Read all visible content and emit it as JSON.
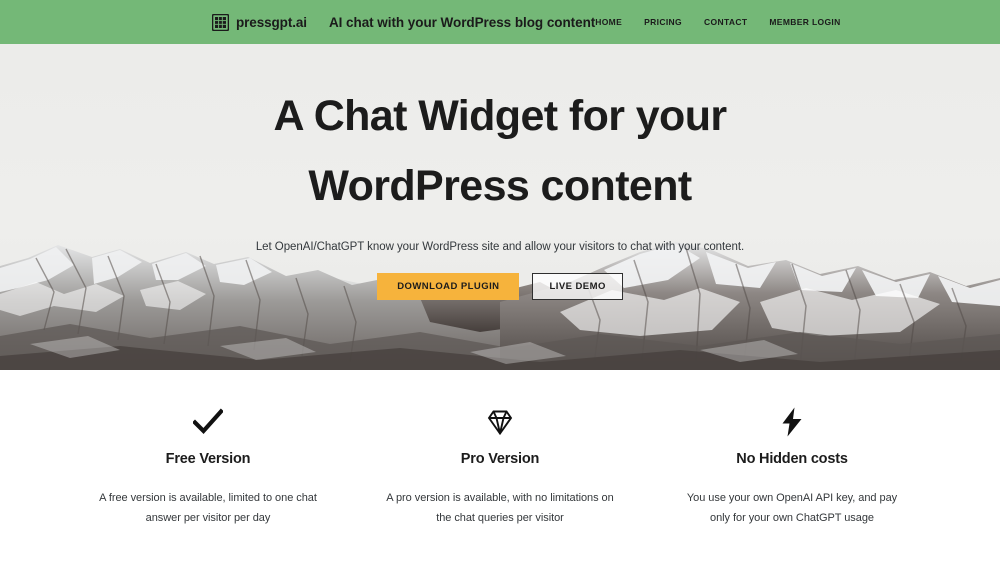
{
  "header": {
    "brand_name": "pressgpt.ai",
    "brand_icon": "grid-logo-icon",
    "tagline": "AI chat with your WordPress blog content",
    "background_color": "#74b877",
    "nav": [
      {
        "label": "HOME"
      },
      {
        "label": "PRICING"
      },
      {
        "label": "CONTACT"
      },
      {
        "label": "MEMBER LOGIN"
      }
    ]
  },
  "hero": {
    "title_line1": "A Chat Widget for your",
    "title_line2": "WordPress content",
    "subtitle": "Let OpenAI/ChatGPT know your WordPress site and allow your visitors to chat with your content.",
    "background_image": "snow-capped-mountain-range-photo",
    "primary_button": {
      "label": "DOWNLOAD PLUGIN",
      "color": "#f6b33c"
    },
    "secondary_button": {
      "label": "LIVE DEMO",
      "border_color": "#2f2f2f"
    }
  },
  "features": [
    {
      "icon": "checkmark-icon",
      "title": "Free Version",
      "description": "A free version is available, limited to one chat answer per visitor per day"
    },
    {
      "icon": "diamond-icon",
      "title": "Pro Version",
      "description": "A pro version is available, with no limitations on the chat queries per visitor"
    },
    {
      "icon": "lightning-bolt-icon",
      "title": "No Hidden costs",
      "description": "You use your own OpenAI API key, and pay only for your own ChatGPT usage"
    }
  ]
}
